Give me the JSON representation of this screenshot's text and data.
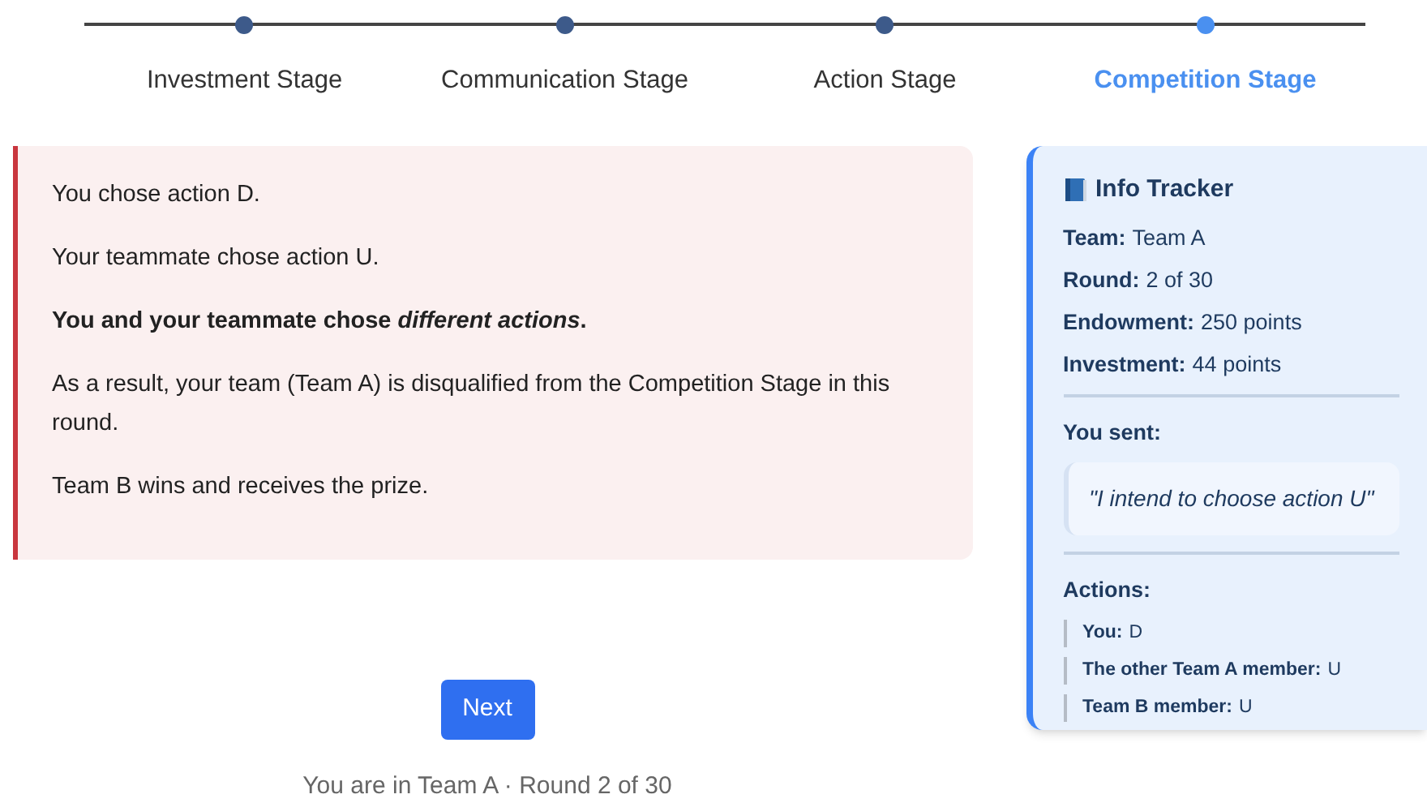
{
  "steps": [
    {
      "label": "Investment Stage",
      "selected": false
    },
    {
      "label": "Communication Stage",
      "selected": false
    },
    {
      "label": "Action Stage",
      "selected": false
    },
    {
      "label": "Competition Stage",
      "selected": true
    }
  ],
  "result": {
    "paragraphs": [
      "You chose action D.",
      "Your teammate chose action U.",
      "You and your teammate chose *different actions*.",
      "As a result, your team (Team A) is disqualified from the Competition Stage in this round.",
      "Team B wins and receives the prize."
    ],
    "emphasis": [
      false,
      false,
      true,
      false,
      false
    ]
  },
  "next_button": "Next",
  "footer": "You are in Team A · Round 2 of 30",
  "tracker": {
    "title": "Info Tracker",
    "fields": [
      {
        "label": "Team:",
        "value": "Team A"
      },
      {
        "label": "Round:",
        "value": "2 of 30"
      },
      {
        "label": "Endowment:",
        "value": "250 points"
      },
      {
        "label": "Investment:",
        "value": "44 points"
      }
    ],
    "sent_label": "You sent:",
    "message": "\"I intend to choose action U\"",
    "actions_label": "Actions:",
    "actions": [
      {
        "label": "You:",
        "value": "D"
      },
      {
        "label": "The other Team A member:",
        "value": "U"
      },
      {
        "label": "Team B member:",
        "value": "U"
      }
    ]
  }
}
